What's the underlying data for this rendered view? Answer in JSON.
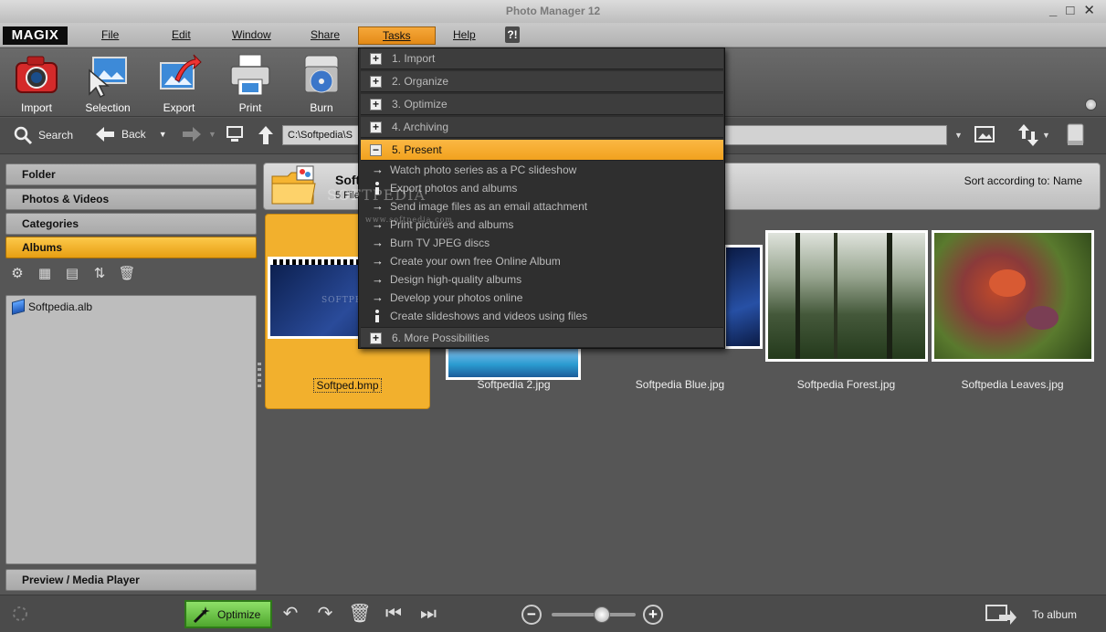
{
  "window": {
    "title": "Photo Manager 12",
    "controls": [
      "_",
      "□",
      "✕"
    ]
  },
  "menubar": {
    "logo": "MAGIX",
    "items": [
      "File",
      "Edit",
      "Window",
      "Share",
      "Tasks",
      "Help"
    ],
    "help_icon": "?!"
  },
  "toolbar": {
    "tools": [
      {
        "label": "Import",
        "icon": "camera-icon"
      },
      {
        "label": "Selection",
        "icon": "selection-cursor-icon"
      },
      {
        "label": "Export",
        "icon": "export-icon"
      },
      {
        "label": "Print",
        "icon": "printer-icon"
      },
      {
        "label": "Burn",
        "icon": "disc-burn-icon"
      }
    ]
  },
  "navbar": {
    "search": "Search",
    "back": "Back",
    "path": "C:\\Softpedia\\S"
  },
  "leftpanel": {
    "sections": [
      "Folder",
      "Photos & Videos",
      "Categories",
      "Albums"
    ],
    "active": "Albums",
    "album_items": [
      "Softpedia.alb"
    ],
    "preview": "Preview / Media Player"
  },
  "header": {
    "title": "Soft",
    "subtitle": "5 File",
    "sort": "Sort according to: Name"
  },
  "thumbnails": [
    {
      "label": "Softped.bmp",
      "selected": true
    },
    {
      "label": "Softpedia 2.jpg",
      "selected": false
    },
    {
      "label": "Softpedia Blue.jpg",
      "selected": false
    },
    {
      "label": "Softpedia Forest.jpg",
      "selected": false
    },
    {
      "label": "Softpedia Leaves.jpg",
      "selected": false
    }
  ],
  "tasks_menu": {
    "sections": [
      {
        "label": "1. Import",
        "expanded": false
      },
      {
        "label": "2. Organize",
        "expanded": false
      },
      {
        "label": "3. Optimize",
        "expanded": false
      },
      {
        "label": "4. Archiving",
        "expanded": false
      },
      {
        "label": "5. Present",
        "expanded": true
      },
      {
        "label": "6. More Possibilities",
        "expanded": false
      }
    ],
    "present_items": [
      {
        "label": "Watch photo series as a PC slideshow",
        "icon": "arrow-right-icon"
      },
      {
        "label": "Export photos and albums",
        "icon": "info-icon"
      },
      {
        "label": "Send image files as an email attachment",
        "icon": "arrow-right-icon"
      },
      {
        "label": "Print pictures and albums",
        "icon": "arrow-right-icon"
      },
      {
        "label": "Burn TV JPEG discs",
        "icon": "arrow-right-icon"
      },
      {
        "label": "Create your own free Online Album",
        "icon": "arrow-right-icon"
      },
      {
        "label": "Design high-quality albums",
        "icon": "arrow-right-icon"
      },
      {
        "label": "Develop your photos online",
        "icon": "arrow-right-icon"
      },
      {
        "label": "Create slideshows and videos using files",
        "icon": "info-icon"
      }
    ]
  },
  "statusbar": {
    "optimize": "Optimize",
    "to_album": "To album"
  },
  "watermark": {
    "text": "SOFTPEDIA",
    "sub": "www.softpedia.com"
  },
  "colors": {
    "accent_orange": "#f2a82a",
    "panel_gray": "#565656",
    "optimize_green": "#5cb83a"
  }
}
